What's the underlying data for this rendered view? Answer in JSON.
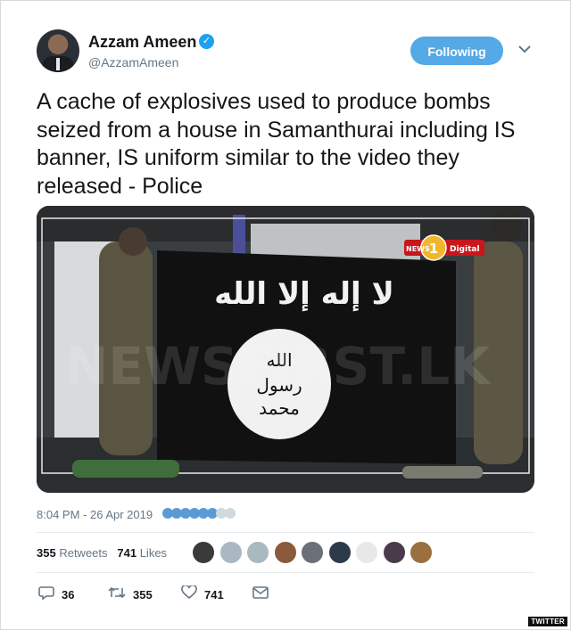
{
  "author": {
    "name": "Azzam Ameen",
    "handle": "@AzzamAmeen",
    "verified_glyph": "✓"
  },
  "follow_button": {
    "label": "Following"
  },
  "menu_icon": "chevron-down-icon",
  "tweet": {
    "text": "A cache of explosives used to produce bombs seized from a house in Samanthurai including IS banner, IS uniform similar to the video they released - Police"
  },
  "media": {
    "channel_logo_text": "Digital",
    "channel_prefix": "NEWS"
  },
  "timestamp": "8:04 PM - 26 Apr 2019",
  "stats": {
    "retweets_count": "355",
    "retweets_label": "Retweets",
    "likes_count": "741",
    "likes_label": "Likes"
  },
  "actions": {
    "reply_count": "36",
    "retweet_count": "355",
    "like_count": "741"
  },
  "source_badge": "TWITTER",
  "colors": {
    "accent": "#1da1f2",
    "follow_bg": "#54a9e6",
    "muted": "#657786",
    "text": "#14171a"
  }
}
